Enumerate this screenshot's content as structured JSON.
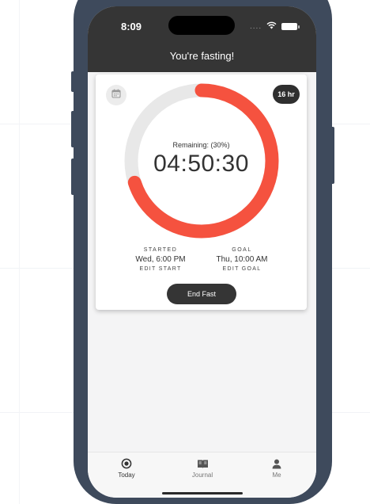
{
  "status_bar": {
    "time": "8:09",
    "signal": "....",
    "wifi_icon": "wifi-icon",
    "battery_icon": "battery-icon"
  },
  "header": {
    "title": "You're fasting!"
  },
  "card": {
    "calendar_icon": "calendar-icon",
    "duration_badge": "16 hr",
    "progress": {
      "remaining_label": "Remaining: (30%)",
      "remaining_percent": 30,
      "time_remaining": "04:50:30"
    },
    "started": {
      "label": "STARTED",
      "value": "Wed, 6:00 PM",
      "edit_label": "EDIT START"
    },
    "goal": {
      "label": "GOAL",
      "value": "Thu, 10:00 AM",
      "edit_label": "EDIT GOAL"
    },
    "end_button": "End Fast"
  },
  "bottom_nav": {
    "items": [
      {
        "label": "Today",
        "icon": "target-icon",
        "active": true
      },
      {
        "label": "Journal",
        "icon": "book-icon",
        "active": false
      },
      {
        "label": "Me",
        "icon": "person-icon",
        "active": false
      }
    ]
  },
  "colors": {
    "accent": "#f5523f",
    "track": "#e8e8e8",
    "header_bg": "#353535",
    "frame": "#3e4a5c"
  }
}
